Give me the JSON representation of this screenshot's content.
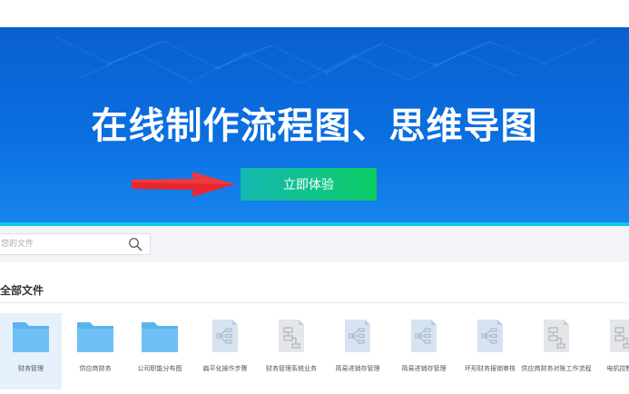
{
  "hero": {
    "title": "在线制作流程图、思维导图",
    "cta_label": "立即体验"
  },
  "search": {
    "placeholder": "您的文件",
    "icon": "search-icon"
  },
  "files": {
    "heading": "全部文件",
    "items": [
      {
        "label": "财务管理",
        "type": "folder",
        "selected": true
      },
      {
        "label": "供应商财务",
        "type": "folder"
      },
      {
        "label": "公司职能分布图",
        "type": "folder"
      },
      {
        "label": "扁平化操作步骤",
        "type": "mindmap"
      },
      {
        "label": "财务管理系统业务",
        "type": "flowchart"
      },
      {
        "label": "简易进销存管理",
        "type": "mindmap"
      },
      {
        "label": "简易进销存管理",
        "type": "mindmap"
      },
      {
        "label": "坏形财务报销审核",
        "type": "mindmap"
      },
      {
        "label": "供应商财务对账工作流程",
        "type": "flowchart"
      },
      {
        "label": "电机控制器",
        "type": "flowchart"
      }
    ]
  },
  "colors": {
    "hero_blue": "#0b6fe0",
    "cta_green": "#10c488",
    "accent_cyan": "#11c7e6",
    "arrow_red": "#e8262c",
    "folder_blue": "#5ab4f0"
  }
}
